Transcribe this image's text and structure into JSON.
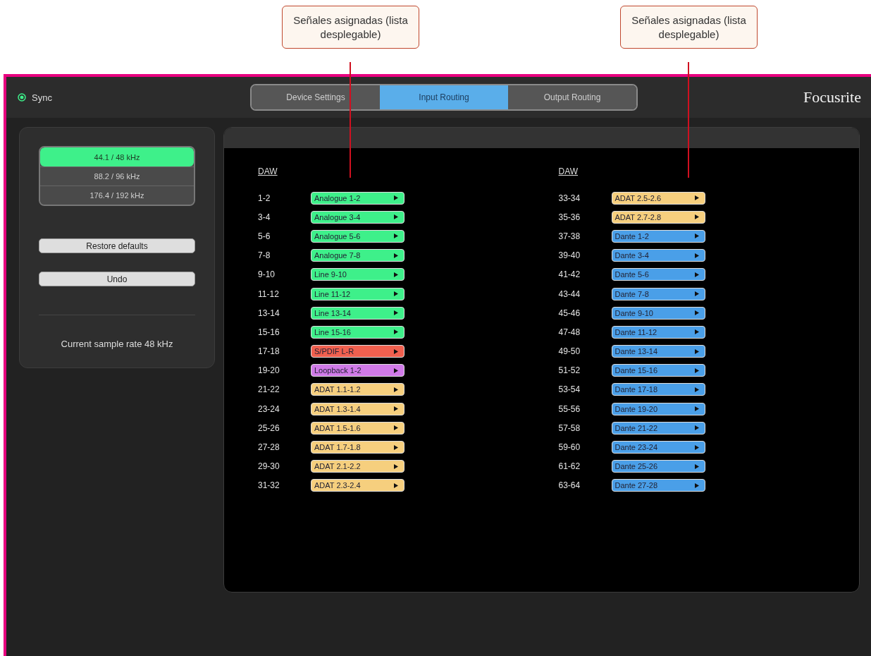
{
  "callouts": [
    {
      "text": "Señales asignadas (lista desplegable)"
    },
    {
      "text": "Señales asignadas (lista desplegable)"
    }
  ],
  "header": {
    "sync": {
      "label": "Sync",
      "on": true
    },
    "logo": "Focusrite"
  },
  "tabs": [
    {
      "label": "Device Settings",
      "selected": false
    },
    {
      "label": "Input Routing",
      "selected": true
    },
    {
      "label": "Output Routing",
      "selected": false
    }
  ],
  "sidebar": {
    "sample_rates": [
      {
        "label": "44.1 / 48 kHz",
        "selected": true
      },
      {
        "label": "88.2 / 96 kHz",
        "selected": false
      },
      {
        "label": "176.4 / 192 kHz",
        "selected": false
      }
    ],
    "buttons": [
      "Restore defaults",
      "Undo"
    ],
    "status": "Current sample rate 48 kHz"
  },
  "routing": {
    "columns": [
      {
        "header": "DAW",
        "rows": [
          {
            "channels": "1-2",
            "source": "Analogue 1-2",
            "color": "#3ef08a"
          },
          {
            "channels": "3-4",
            "source": "Analogue 3-4",
            "color": "#3ef08a"
          },
          {
            "channels": "5-6",
            "source": "Analogue 5-6",
            "color": "#3ef08a"
          },
          {
            "channels": "7-8",
            "source": "Analogue 7-8",
            "color": "#3ef08a"
          },
          {
            "channels": "9-10",
            "source": "Line 9-10",
            "color": "#3ef08a"
          },
          {
            "channels": "11-12",
            "source": "Line 11-12",
            "color": "#3ef08a"
          },
          {
            "channels": "13-14",
            "source": "Line 13-14",
            "color": "#3ef08a"
          },
          {
            "channels": "15-16",
            "source": "Line 15-16",
            "color": "#3ef08a"
          },
          {
            "channels": "17-18",
            "source": "S/PDIF L-R",
            "color": "#f0604f"
          },
          {
            "channels": "19-20",
            "source": "Loopback 1-2",
            "color": "#d07ae8"
          },
          {
            "channels": "21-22",
            "source": "ADAT 1.1-1.2",
            "color": "#f6cf7e"
          },
          {
            "channels": "23-24",
            "source": "ADAT 1.3-1.4",
            "color": "#f6cf7e"
          },
          {
            "channels": "25-26",
            "source": "ADAT 1.5-1.6",
            "color": "#f6cf7e"
          },
          {
            "channels": "27-28",
            "source": "ADAT 1.7-1.8",
            "color": "#f6cf7e"
          },
          {
            "channels": "29-30",
            "source": "ADAT 2.1-2.2",
            "color": "#f6cf7e"
          },
          {
            "channels": "31-32",
            "source": "ADAT 2.3-2.4",
            "color": "#f6cf7e"
          }
        ]
      },
      {
        "header": "DAW",
        "rows": [
          {
            "channels": "33-34",
            "source": "ADAT 2.5-2.6",
            "color": "#f6cf7e"
          },
          {
            "channels": "35-36",
            "source": "ADAT 2.7-2.8",
            "color": "#f6cf7e"
          },
          {
            "channels": "37-38",
            "source": "Dante 1-2",
            "color": "#4a9fe8"
          },
          {
            "channels": "39-40",
            "source": "Dante 3-4",
            "color": "#4a9fe8"
          },
          {
            "channels": "41-42",
            "source": "Dante 5-6",
            "color": "#4a9fe8"
          },
          {
            "channels": "43-44",
            "source": "Dante 7-8",
            "color": "#4a9fe8"
          },
          {
            "channels": "45-46",
            "source": "Dante 9-10",
            "color": "#4a9fe8"
          },
          {
            "channels": "47-48",
            "source": "Dante 11-12",
            "color": "#4a9fe8"
          },
          {
            "channels": "49-50",
            "source": "Dante 13-14",
            "color": "#4a9fe8"
          },
          {
            "channels": "51-52",
            "source": "Dante 15-16",
            "color": "#4a9fe8"
          },
          {
            "channels": "53-54",
            "source": "Dante 17-18",
            "color": "#4a9fe8"
          },
          {
            "channels": "55-56",
            "source": "Dante 19-20",
            "color": "#4a9fe8"
          },
          {
            "channels": "57-58",
            "source": "Dante 21-22",
            "color": "#4a9fe8"
          },
          {
            "channels": "59-60",
            "source": "Dante 23-24",
            "color": "#4a9fe8"
          },
          {
            "channels": "61-62",
            "source": "Dante 25-26",
            "color": "#4a9fe8"
          },
          {
            "channels": "63-64",
            "source": "Dante 27-28",
            "color": "#4a9fe8"
          }
        ]
      }
    ]
  }
}
